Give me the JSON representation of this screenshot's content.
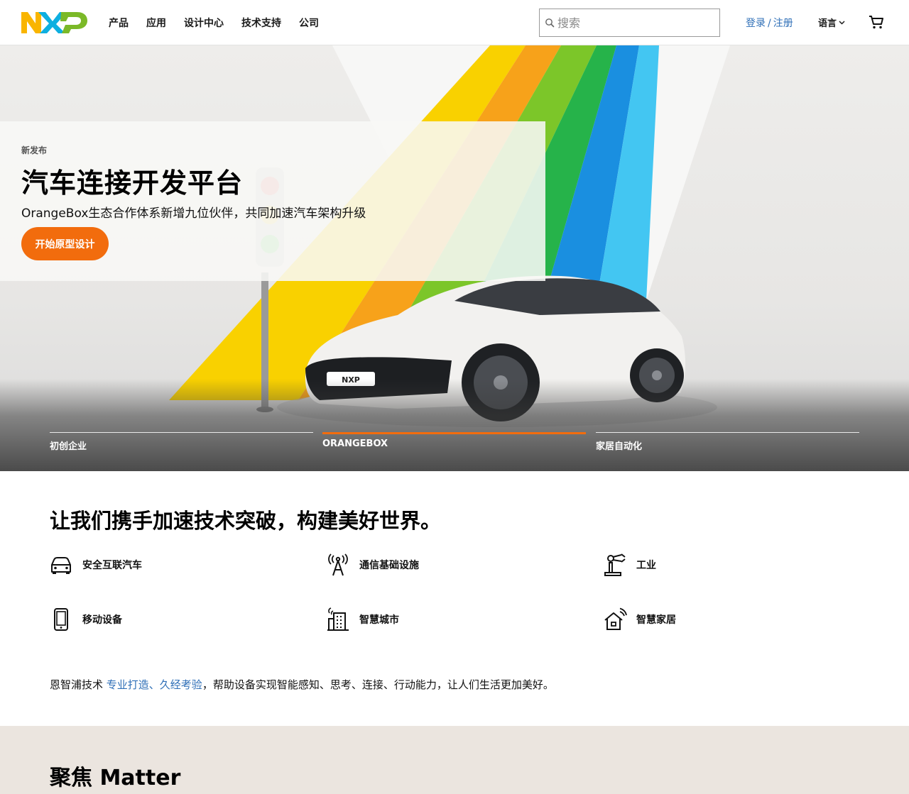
{
  "brand": {
    "logo_text": "NXP",
    "colors": {
      "orange": "#f9b500",
      "blue": "#0eafe0",
      "green": "#7bb928",
      "accent": "#f26c0d",
      "link": "#2f6fb7"
    }
  },
  "header": {
    "nav": [
      "产品",
      "应用",
      "设计中心",
      "技术支持",
      "公司"
    ],
    "search_placeholder": "搜索",
    "login": "登录",
    "login_sep": "/",
    "register": "注册",
    "language": "语言",
    "icons": {
      "search": "search-icon",
      "language_chevron": "chevron-down-icon",
      "cart": "cart-icon"
    }
  },
  "hero": {
    "kicker": "新发布",
    "title": "汽车连接开发平台",
    "subtitle": "OrangeBox生态合作体系新增九位伙伴，共同加速汽车架构升级",
    "cta": "开始原型设计",
    "car_badge": "NXP",
    "tabs": [
      {
        "label": "初创企业",
        "active": false
      },
      {
        "label": "ORANGEBOX",
        "active": true
      },
      {
        "label": "家居自动化",
        "active": false
      }
    ]
  },
  "section": {
    "title": "让我们携手加速技术突破，构建美好世界。",
    "categories": [
      {
        "label": "安全互联汽车",
        "icon": "car-icon"
      },
      {
        "label": "通信基础设施",
        "icon": "antenna-tower-icon"
      },
      {
        "label": "工业",
        "icon": "robot-arm-icon"
      },
      {
        "label": "移动设备",
        "icon": "smartphone-icon"
      },
      {
        "label": "智慧城市",
        "icon": "smart-city-icon"
      },
      {
        "label": "智慧家居",
        "icon": "smart-home-icon"
      }
    ],
    "intro_prefix": "恩智浦技术",
    "intro_link": "专业打造、久经考验",
    "intro_suffix": "，帮助设备实现智能感知、思考、连接、行动能力，让人们生活更加美好。"
  },
  "matter": {
    "title": "聚焦 Matter"
  }
}
